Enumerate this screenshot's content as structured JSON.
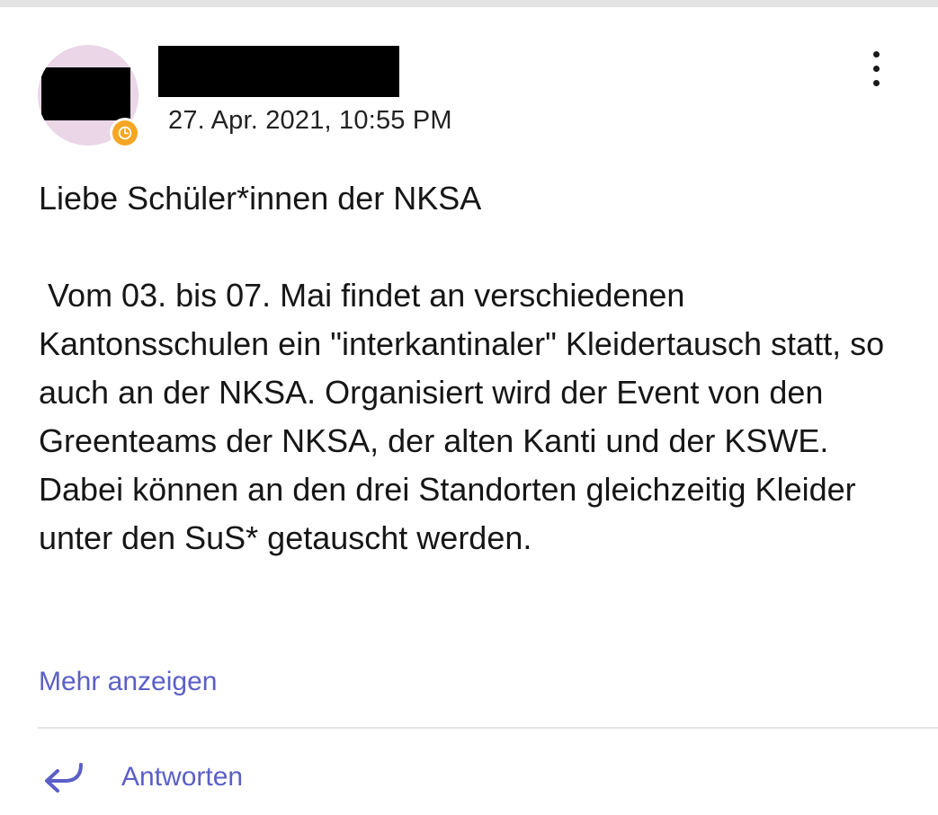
{
  "post": {
    "author_name": "",
    "timestamp": "27. Apr. 2021, 10:55 PM",
    "status": "away",
    "status_icon": "clock-icon",
    "more_options_icon": "more-vertical-icon",
    "greeting": "Liebe Schüler*innen der NKSA",
    "body": " Vom 03. bis 07. Mai findet an verschiedenen Kantonsschulen ein \"interkantinaler\" Kleidertausch statt, so auch an der NKSA. Organisiert wird der Event von den Greenteams der NKSA, der alten Kanti und der KSWE. Dabei können an den drei Standorten gleichzeitig Kleider unter den SuS* getauscht werden."
  },
  "actions": {
    "show_more_label": "Mehr anzeigen",
    "reply_label": "Antworten",
    "reply_icon": "reply-arrow-icon"
  },
  "colors": {
    "accent": "#5b5fc7",
    "avatar_bg": "#ead6e6",
    "status_away": "#f5a623",
    "divider": "#e6e6e6"
  }
}
